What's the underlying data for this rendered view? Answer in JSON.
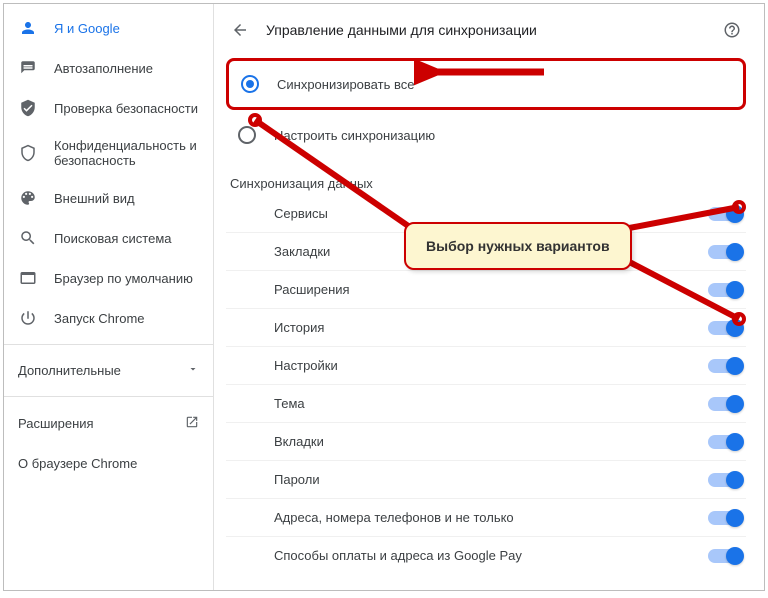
{
  "sidebar": {
    "items": [
      {
        "label": "Я и Google",
        "icon": "person-icon",
        "active": true
      },
      {
        "label": "Автозаполнение",
        "icon": "autofill-icon",
        "active": false
      },
      {
        "label": "Проверка безопасности",
        "icon": "safety-check-icon",
        "active": false
      },
      {
        "label": "Конфиденциальность и безопасность",
        "icon": "security-icon",
        "active": false
      },
      {
        "label": "Внешний вид",
        "icon": "appearance-icon",
        "active": false
      },
      {
        "label": "Поисковая система",
        "icon": "search-icon",
        "active": false
      },
      {
        "label": "Браузер по умолчанию",
        "icon": "default-browser-icon",
        "active": false
      },
      {
        "label": "Запуск Chrome",
        "icon": "startup-icon",
        "active": false
      }
    ],
    "advanced_label": "Дополнительные",
    "extensions_label": "Расширения",
    "about_label": "О браузере Chrome"
  },
  "header": {
    "title": "Управление данными для синхронизации"
  },
  "sync": {
    "option_all": "Синхронизировать все",
    "option_custom": "Настроить синхронизацию",
    "section_title": "Синхронизация данных",
    "items": [
      {
        "label": "Сервисы",
        "on": true
      },
      {
        "label": "Закладки",
        "on": true
      },
      {
        "label": "Расширения",
        "on": true
      },
      {
        "label": "История",
        "on": true
      },
      {
        "label": "Настройки",
        "on": true
      },
      {
        "label": "Тема",
        "on": true
      },
      {
        "label": "Вкладки",
        "on": true
      },
      {
        "label": "Пароли",
        "on": true
      },
      {
        "label": "Адреса, номера телефонов и не только",
        "on": true
      },
      {
        "label": "Способы оплаты и адреса из Google Pay",
        "on": true
      }
    ]
  },
  "annotation": {
    "tooltip_text": "Выбор нужных вариантов"
  }
}
